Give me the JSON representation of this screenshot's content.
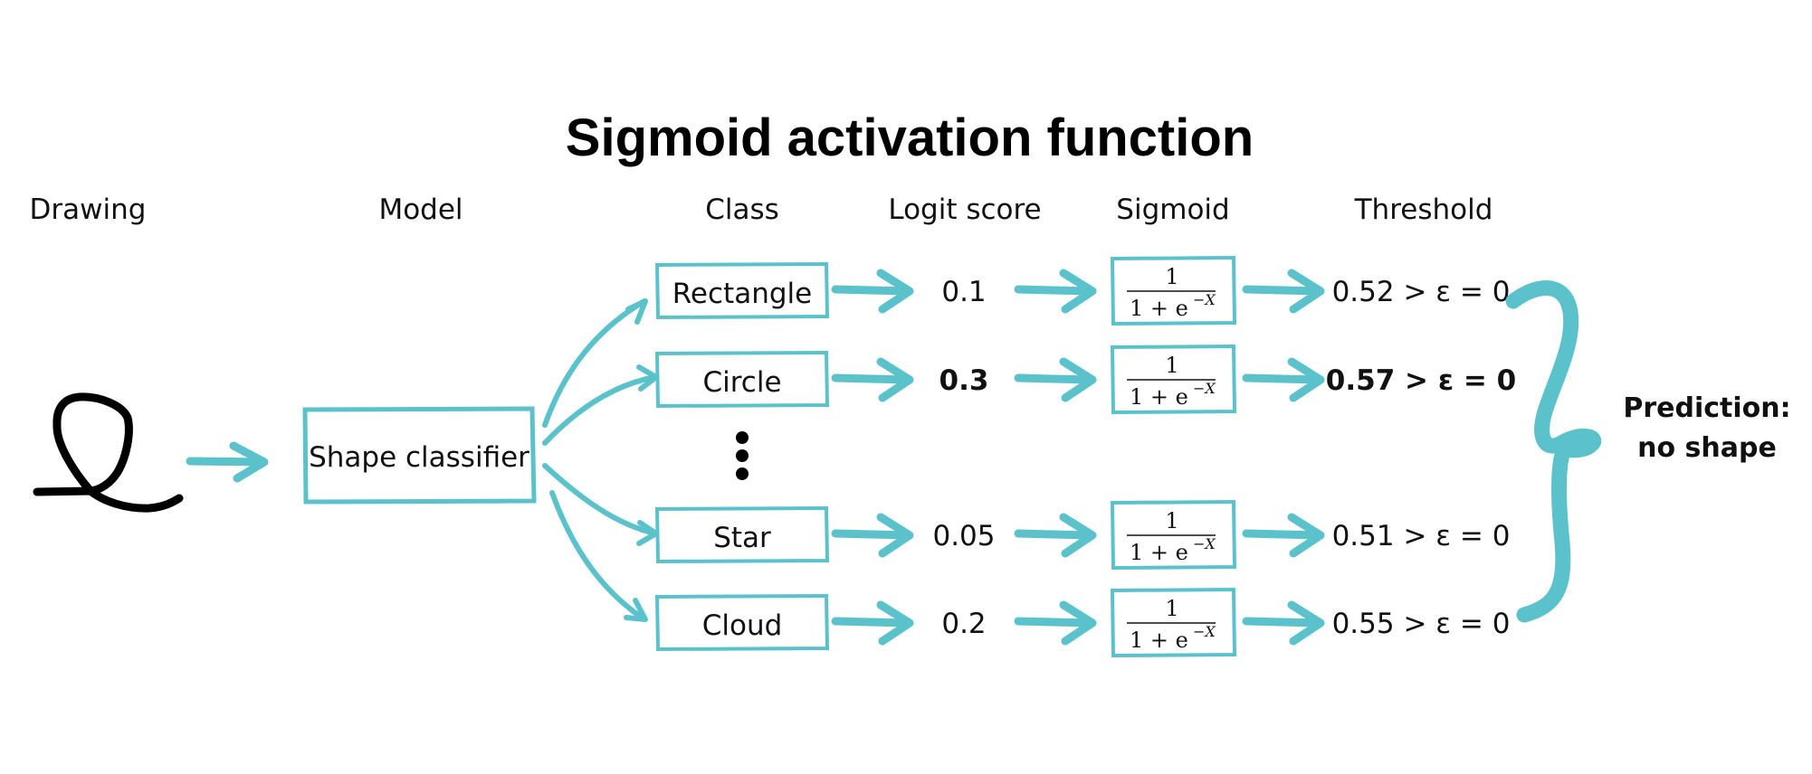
{
  "title": "Sigmoid activation function",
  "headers": {
    "drawing": "Drawing",
    "model": "Model",
    "class": "Class",
    "logit": "Logit score",
    "sigmoid": "Sigmoid",
    "threshold": "Threshold"
  },
  "model_label": "Shape classifier",
  "sigmoid_formula": {
    "numerator": "1",
    "denominator_base": "1 + e",
    "exponent": "−X"
  },
  "rows": [
    {
      "class": "Rectangle",
      "logit": "0.1",
      "threshold": "0.52 > ε = 0",
      "highlight": false
    },
    {
      "class": "Circle",
      "logit": "0.3",
      "threshold": "0.57 > ε = 0",
      "highlight": true
    },
    {
      "class": "Star",
      "logit": "0.05",
      "threshold": "0.51 > ε = 0",
      "highlight": false
    },
    {
      "class": "Cloud",
      "logit": "0.2",
      "threshold": "0.55 > ε = 0",
      "highlight": false
    }
  ],
  "prediction": {
    "line1": "Prediction:",
    "line2": "no shape"
  },
  "colors": {
    "accent": "#5bc2cb",
    "ink": "#000000"
  }
}
